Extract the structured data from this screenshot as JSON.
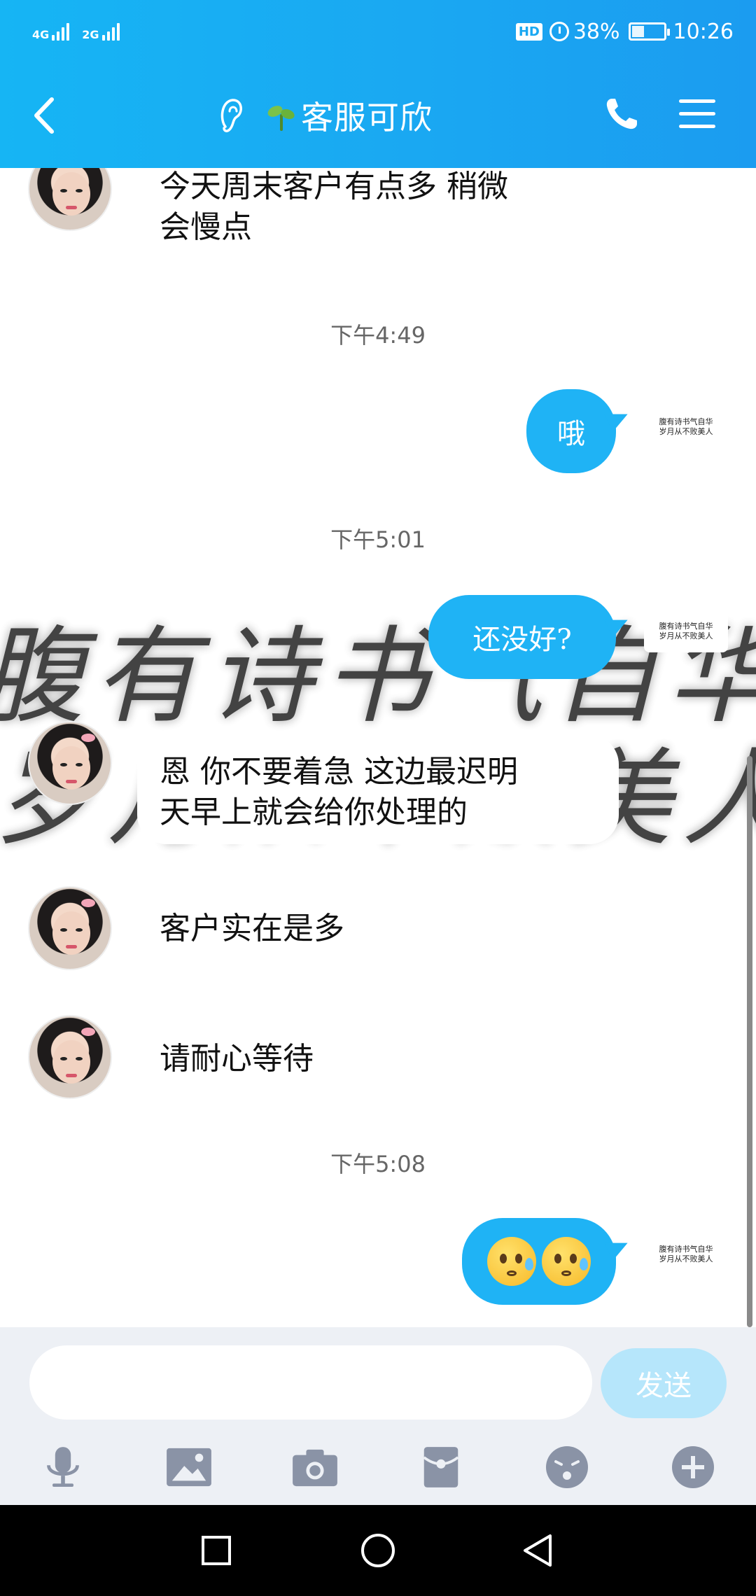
{
  "status_bar": {
    "net1_label": "4G",
    "net2_label": "2G",
    "hd_label": "HD",
    "battery_percent_text": "38%",
    "battery_level": 0.38,
    "time": "10:26"
  },
  "header": {
    "title": "客服可欣",
    "accent_color": "#1aa8f2"
  },
  "messages": {
    "m1": {
      "text_line1": "今天周末客户有点多  稍微",
      "text_line2": "会慢点"
    },
    "ts1": "下午4:49",
    "m2": {
      "text": "哦"
    },
    "ts2": "下午5:01",
    "m3": {
      "text": "还没好?"
    },
    "m4": {
      "line1": "恩 你不要着急 这边最迟明",
      "line2": "天早上就会给你处理的"
    },
    "m5": {
      "text": "客户实在是多"
    },
    "m6": {
      "text": "请耐心等待"
    },
    "ts3": "下午5:08",
    "m7": {
      "emoji_names": [
        "sweat-face-icon",
        "sweat-face-icon"
      ]
    }
  },
  "watermark": {
    "line1": "腹有诗书气自华",
    "line2": "岁月从不败美人"
  },
  "signature_avatar": {
    "line1": "腹有诗书气自华",
    "line2": "岁月从不败美人"
  },
  "input": {
    "value": "",
    "send_label": "发送",
    "send_color": "#b6e6fb"
  },
  "toolbar": {
    "icons": [
      "microphone-icon",
      "image-icon",
      "camera-icon",
      "red-packet-icon",
      "emoji-icon",
      "plus-icon"
    ]
  },
  "nav": {
    "icons": [
      "recent-apps-icon",
      "home-icon",
      "back-icon"
    ]
  }
}
